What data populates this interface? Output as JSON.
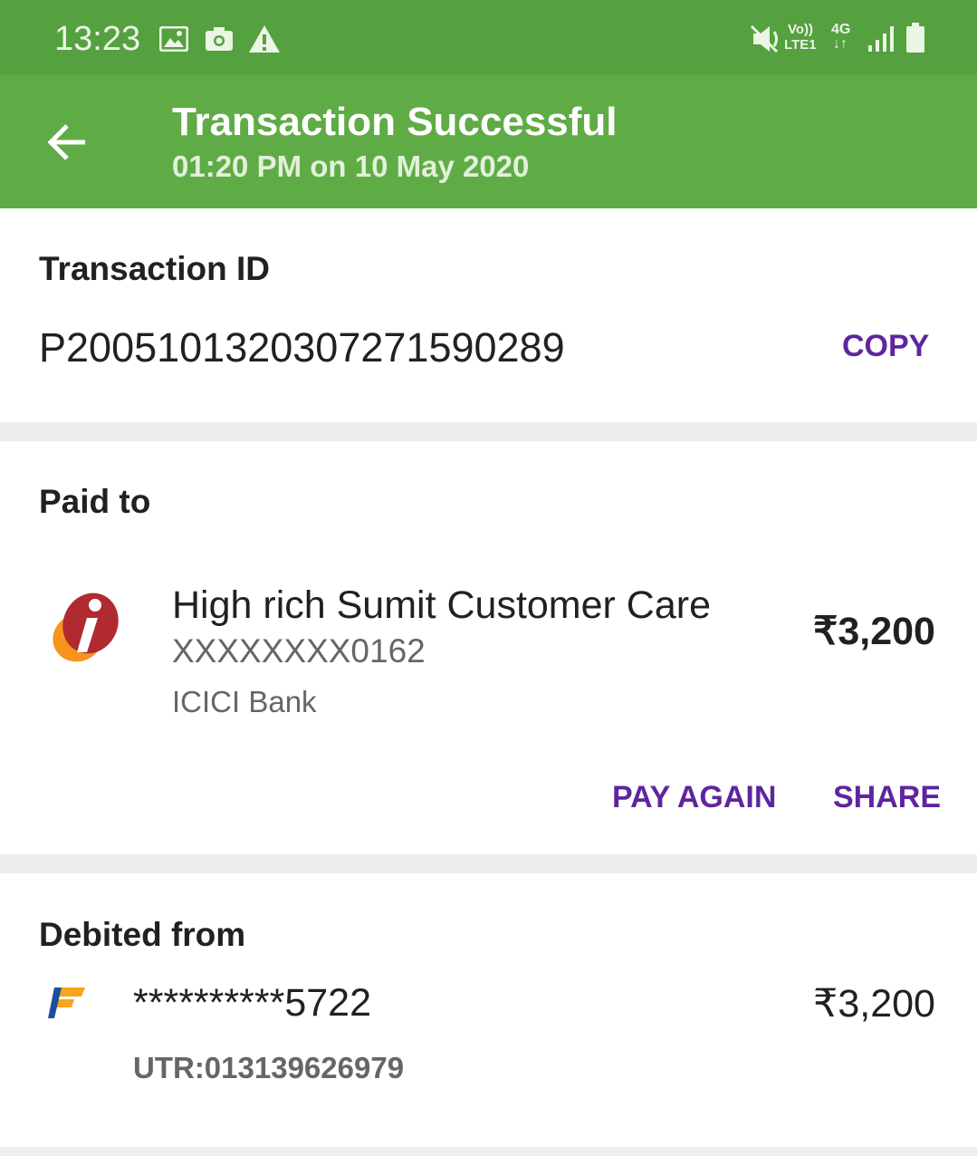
{
  "status_bar": {
    "time": "13:23",
    "network_vo": "Vo))",
    "network_lte": "LTE1",
    "network_4g": "4G"
  },
  "header": {
    "title": "Transaction Successful",
    "subtitle": "01:20 PM on 10 May 2020"
  },
  "transaction": {
    "label": "Transaction ID",
    "id": "P2005101320307271590289",
    "copy_label": "COPY"
  },
  "paid_to": {
    "label": "Paid to",
    "name": "High rich Sumit Customer Care",
    "account": "XXXXXXXX0162",
    "bank": "ICICI Bank",
    "amount": "₹3,200",
    "pay_again_label": "PAY AGAIN",
    "share_label": "SHARE"
  },
  "debited_from": {
    "label": "Debited from",
    "account": "**********5722",
    "amount": "₹3,200",
    "utr": "UTR:013139626979"
  },
  "colors": {
    "status_bar": "#55a03f",
    "app_bar": "#5fac46",
    "accent": "#5f259f",
    "divider": "#eeeeee"
  },
  "icons": [
    "image-icon",
    "camera-icon",
    "warning-icon",
    "mute-icon",
    "signal-icon",
    "battery-icon",
    "back-arrow-icon",
    "icici-logo-icon",
    "federal-bank-logo-icon"
  ]
}
